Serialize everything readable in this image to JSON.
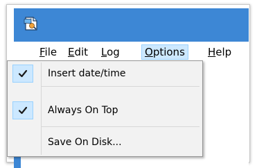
{
  "window": {
    "accent_color": "#3d87d5",
    "icon": "app-document-icon"
  },
  "menubar": {
    "items": [
      {
        "first": "F",
        "rest": "ile"
      },
      {
        "first": "E",
        "rest": "dit"
      },
      {
        "first": "L",
        "rest": "og"
      },
      {
        "first": "O",
        "rest": "ptions"
      },
      {
        "first": "H",
        "rest": "elp"
      }
    ]
  },
  "options_menu": {
    "items": [
      {
        "label": "Insert date/time",
        "checked": true,
        "icon": "checkmark-icon"
      },
      {
        "label": "Always On Top",
        "checked": true,
        "icon": "checkmark-icon"
      },
      {
        "label": "Save On Disk...",
        "checked": false
      }
    ]
  }
}
